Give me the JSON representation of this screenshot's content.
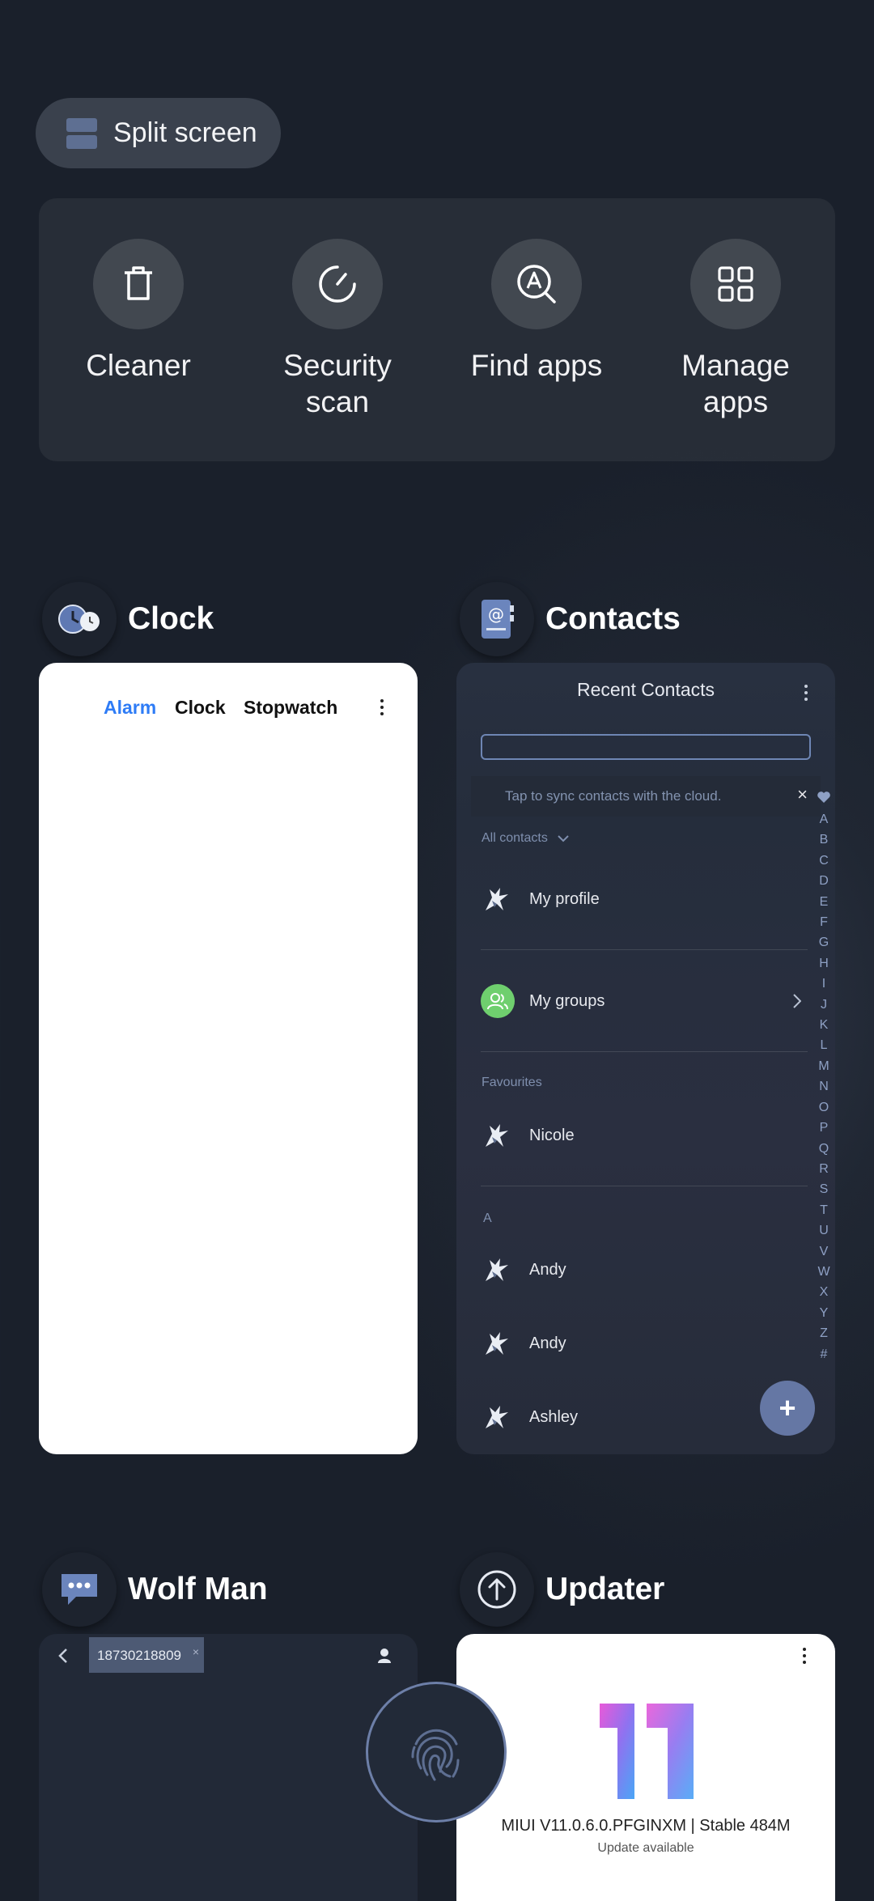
{
  "split_screen": {
    "label": "Split screen",
    "icon": "split-screen-icon"
  },
  "tools": [
    {
      "label": "Cleaner",
      "icon": "trash-icon"
    },
    {
      "label": "Security scan",
      "icon": "gauge-icon"
    },
    {
      "label": "Find apps",
      "icon": "search-app-icon"
    },
    {
      "label": "Manage apps",
      "icon": "grid-icon"
    }
  ],
  "clock_app": {
    "title": "Clock",
    "tabs": [
      "Alarm",
      "Clock",
      "Stopwatch"
    ],
    "active_tab_color": "#2e7cf6"
  },
  "contacts_app": {
    "title": "Contacts",
    "header": "Recent  Contacts",
    "sync_text": "Tap to sync contacts with the cloud.",
    "sync_close": "×",
    "filter_label": "All contacts",
    "my_profile": "My profile",
    "my_groups": "My groups",
    "favourites_label": "Favourites",
    "favourite_contacts": [
      "Nicole"
    ],
    "section_a": "A",
    "contacts_a": [
      "Andy",
      "Andy",
      "Ashley"
    ],
    "alphabet": [
      "A",
      "B",
      "C",
      "D",
      "E",
      "F",
      "G",
      "H",
      "I",
      "J",
      "K",
      "L",
      "M",
      "N",
      "O",
      "P",
      "Q",
      "R",
      "S",
      "T",
      "U",
      "V",
      "W",
      "X",
      "Y",
      "Z",
      "#"
    ],
    "fab": "+"
  },
  "wolfman_app": {
    "title": "Wolf Man",
    "recipient_chip": "18730218809",
    "chip_remove": "×"
  },
  "updater_app": {
    "title": "Updater",
    "version_text": "MIUI V11.0.6.0.PFGINXM | Stable 484M",
    "status_text": "Update available"
  },
  "colors": {
    "background": "#1f2631",
    "accent_blue": "#2e7cf6",
    "fab": "#6577a4",
    "groups_avatar": "#6fcf6e"
  }
}
